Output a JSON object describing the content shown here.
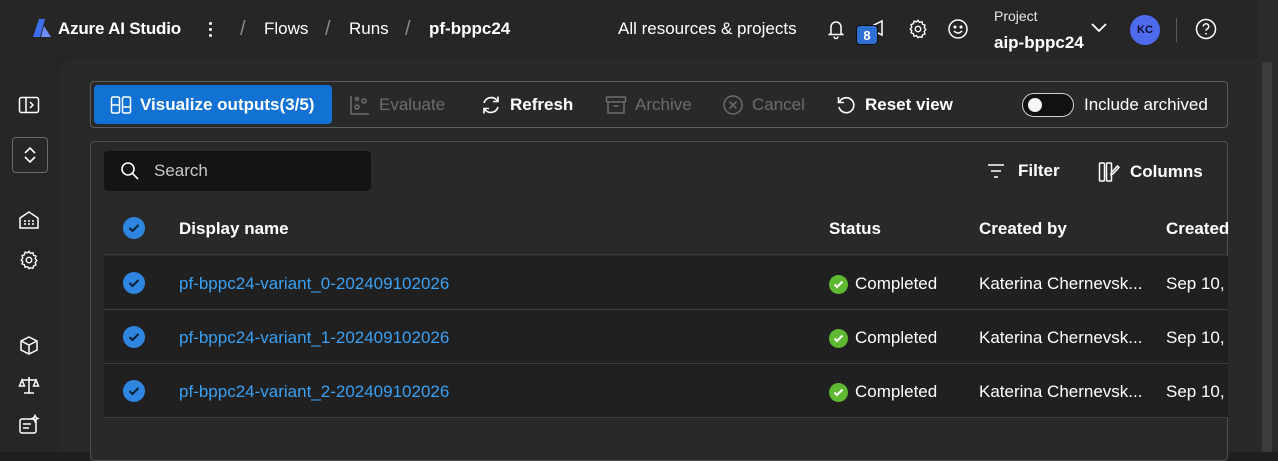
{
  "app": {
    "title": "Azure AI Studio"
  },
  "breadcrumb": [
    {
      "label": "Flows"
    },
    {
      "label": "Runs"
    },
    {
      "label": "pf-bppc24"
    }
  ],
  "header": {
    "all_resources": "All resources & projects",
    "notification_count": "8",
    "project_label": "Project",
    "project_name": "aip-bppc24",
    "avatar_initials": "KC"
  },
  "toolbar": {
    "visualize_label": "Visualize outputs(3/5)",
    "evaluate_label": "Evaluate",
    "refresh_label": "Refresh",
    "archive_label": "Archive",
    "cancel_label": "Cancel",
    "reset_label": "Reset view",
    "include_archived_label": "Include archived",
    "include_archived_on": false
  },
  "search": {
    "placeholder": "Search"
  },
  "table": {
    "filter_label": "Filter",
    "columns_label": "Columns",
    "headers": [
      "Display name",
      "Status",
      "Created by",
      "Created"
    ],
    "rows": [
      {
        "name": "pf-bppc24-variant_0-202409102026",
        "status": "Completed",
        "created_by": "Katerina Chernevsk...",
        "created": "Sep 10,"
      },
      {
        "name": "pf-bppc24-variant_1-202409102026",
        "status": "Completed",
        "created_by": "Katerina Chernevsk...",
        "created": "Sep 10,"
      },
      {
        "name": "pf-bppc24-variant_2-202409102026",
        "status": "Completed",
        "created_by": "Katerina Chernevsk...",
        "created": "Sep 10,"
      }
    ]
  },
  "colors": {
    "accent": "#1172d4",
    "link": "#3aa0f3",
    "success": "#5fb832",
    "avatar": "#4f6bed"
  }
}
